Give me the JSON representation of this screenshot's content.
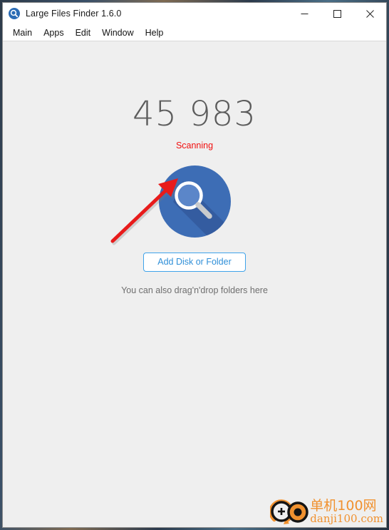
{
  "window": {
    "title": "Large Files Finder 1.6.0",
    "app_icon": "magnifier-icon",
    "controls": {
      "minimize": "—",
      "maximize": "□",
      "close": "✕"
    }
  },
  "menubar": {
    "items": [
      {
        "label": "Main"
      },
      {
        "label": "Apps"
      },
      {
        "label": "Edit"
      },
      {
        "label": "Window"
      },
      {
        "label": "Help"
      }
    ]
  },
  "main": {
    "counter": "45 983",
    "status": "Scanning",
    "status_color": "#f10f0f",
    "logo_icon": "magnifier-circle-icon",
    "add_button_label": "Add Disk or Folder",
    "drop_hint": "You can also drag'n'drop folders here",
    "accent_color": "#3fa3ea"
  },
  "annotation": {
    "arrow_icon": "red-arrow-icon",
    "arrow_color": "#e81b1b"
  },
  "watermark": {
    "logo_icon": "danji100-logo-icon",
    "cn_text": "单机100网",
    "en_text": "danji100.com",
    "color": "#f0912f"
  }
}
